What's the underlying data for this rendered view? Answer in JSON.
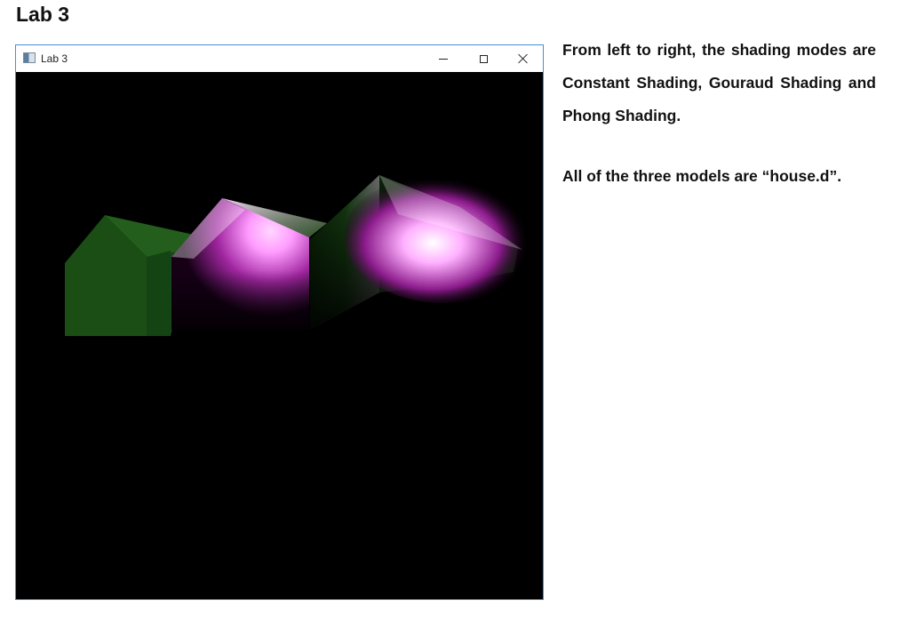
{
  "page": {
    "heading": "Lab 3",
    "paragraph_1": "From left to right, the shading modes are Constant Shading, Gouraud Shading and Phong Shading.",
    "paragraph_2": "All of the three models are “house.d”."
  },
  "window": {
    "title": "Lab 3",
    "buttons": [
      "minimize",
      "maximize",
      "close"
    ],
    "canvas_background": "#000000",
    "border_color": "#4a8fd0"
  },
  "scene": {
    "models": [
      {
        "file": "house.d",
        "shading": "Constant Shading",
        "base_color": "#1a5a14"
      },
      {
        "file": "house.d",
        "shading": "Gouraud Shading",
        "base_color": "#1a5a14",
        "highlight_color": "#ffb3ff"
      },
      {
        "file": "house.d",
        "shading": "Phong Shading",
        "base_color": "#1a5a14",
        "highlight_color": "#ffb3ff"
      }
    ]
  }
}
